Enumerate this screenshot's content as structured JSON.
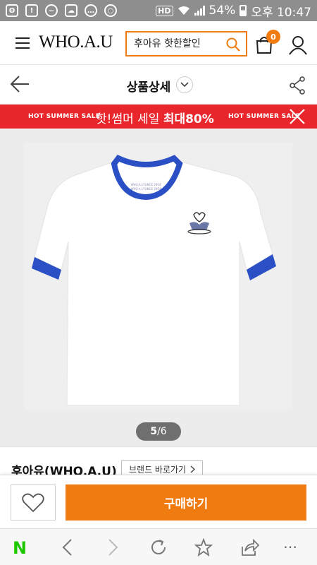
{
  "status_bar": {
    "hd": "HD",
    "battery": "54%",
    "time": "오후 10:47"
  },
  "header": {
    "logo": "WHO.A.U",
    "search_placeholder": "후아유 핫한할인",
    "cart_count": "0"
  },
  "subheader": {
    "title": "상품상세"
  },
  "promo": {
    "left_text": "HOT SUMMER SALE",
    "main_text": "핫!썸머 세일",
    "main_bold": "최대80%",
    "right_text": "HOT SUMMER SALE",
    "color": "#e8262c"
  },
  "product": {
    "pager_current": "5",
    "pager_total": "/6",
    "print_line1": "WHO.A.U SINCE 2004",
    "print_line2": "WHO.A.U SINCE 2004"
  },
  "brand": {
    "name": "후아유(WHO.A.U)",
    "link_label": "브랜드 바로가기"
  },
  "actions": {
    "buy_label": "구매하기",
    "accent": "#f07b10"
  },
  "browser_bar": {
    "naver_logo": "N",
    "more": "⋯"
  }
}
